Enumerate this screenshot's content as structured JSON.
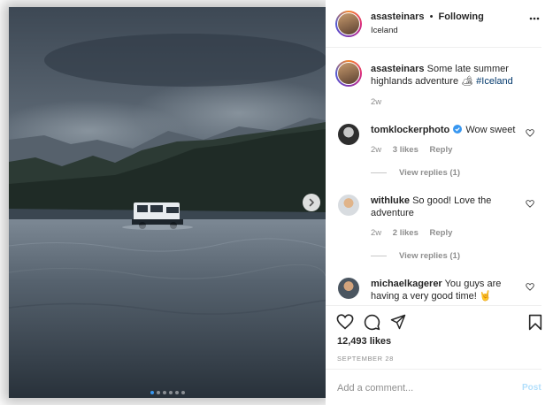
{
  "post": {
    "username": "asasteinars",
    "follow_separator": "•",
    "follow_status": "Following",
    "location": "Iceland",
    "caption_text": "Some late summer highlands adventure 🏕",
    "caption_hashtag": "#Iceland",
    "caption_age": "2w",
    "likes": "12,493 likes",
    "date": "SEPTEMBER 28"
  },
  "comments": [
    {
      "username": "tomklockerphoto",
      "verified": true,
      "text": "Wow sweet",
      "age": "2w",
      "likes": "3 likes",
      "reply": "Reply",
      "view_replies": "View replies (1)"
    },
    {
      "username": "withluke",
      "verified": false,
      "text": "So good! Love the adventure",
      "age": "2w",
      "likes": "2 likes",
      "reply": "Reply",
      "view_replies": "View replies (1)"
    },
    {
      "username": "michaelkagerer",
      "verified": false,
      "text": "You guys are having a very good time! 🤘"
    }
  ],
  "add_comment": {
    "placeholder": "Add a comment...",
    "post_label": "Post"
  },
  "carousel": {
    "slide_count": 6,
    "active_index": 0
  },
  "icons": {
    "more": "more-options-icon",
    "next": "chevron-right-icon",
    "like": "heart-icon",
    "comment": "comment-icon",
    "share": "share-icon",
    "save": "bookmark-icon",
    "verified": "verified-badge-icon"
  },
  "colors": {
    "accent": "#3897f0",
    "post_disabled": "#b2dffc",
    "text": "#262626",
    "muted": "#8e8e8e"
  }
}
